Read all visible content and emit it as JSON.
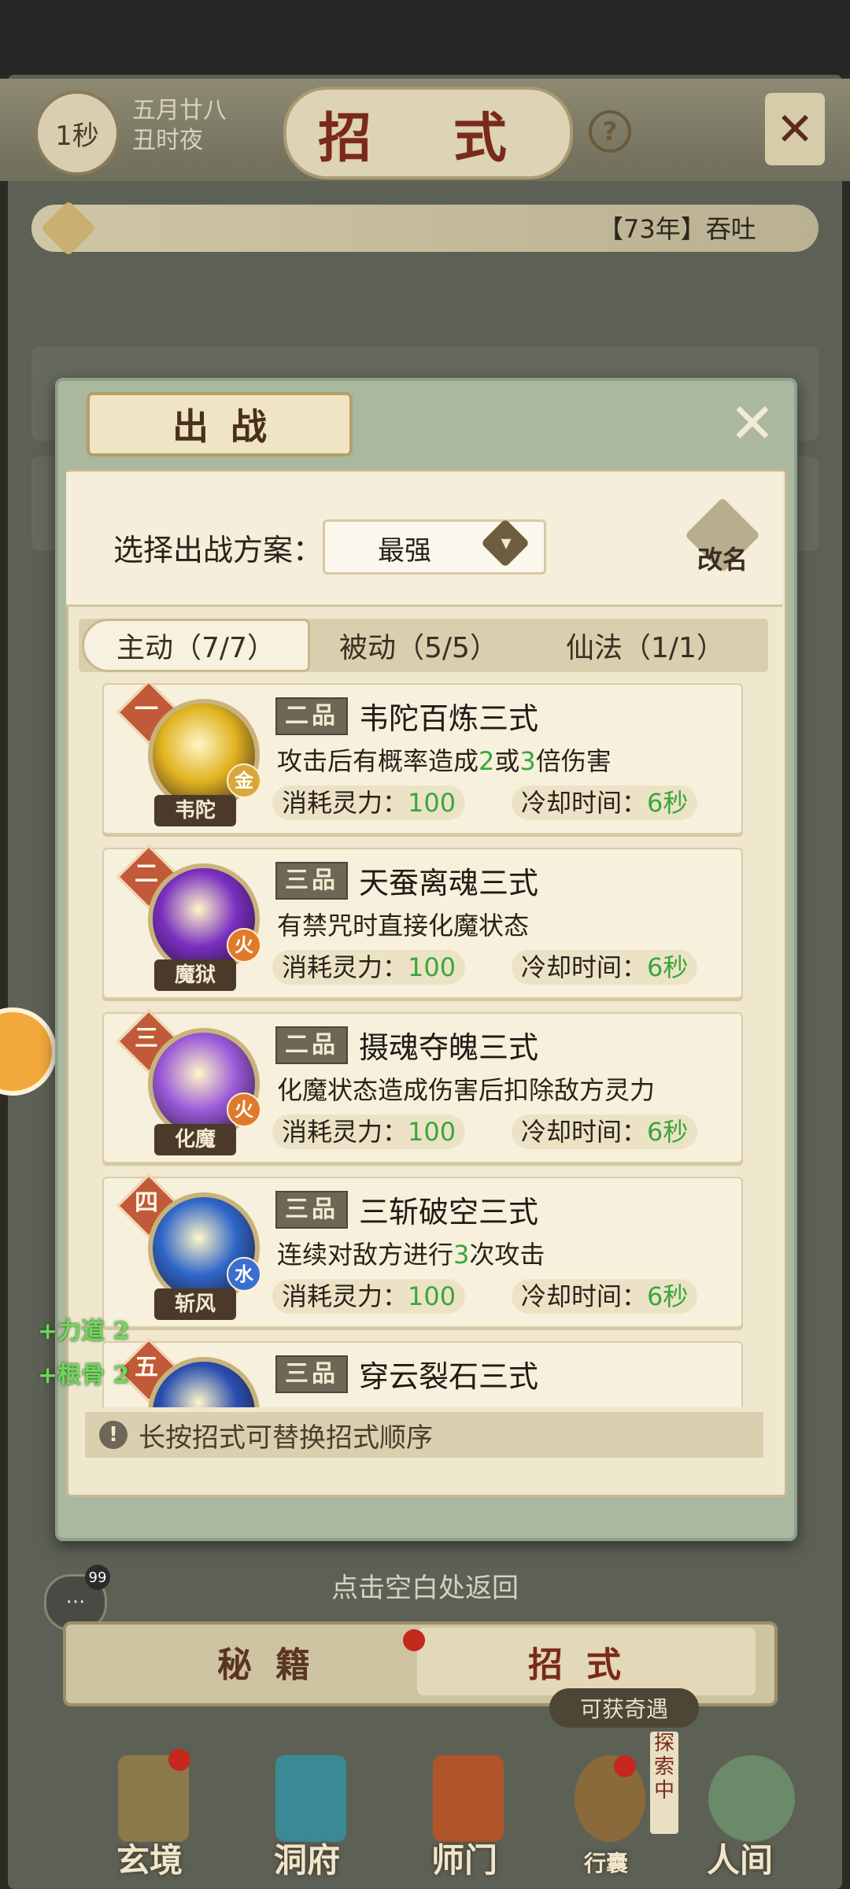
{
  "header": {
    "timer": "1秒",
    "date_line1": "五月廿八",
    "date_line2": "丑时夜",
    "title": "招 式",
    "help": "?",
    "close": "✕"
  },
  "notice": {
    "text": "【73年】吞吐"
  },
  "modal": {
    "title": "出战",
    "close": "✕",
    "plan_label": "选择出战方案：",
    "plan_value": "最强",
    "rename_label": "改名",
    "tabs": [
      {
        "label": "主动（7/7）"
      },
      {
        "label": "被动（5/5）"
      },
      {
        "label": "仙法（1/1）"
      }
    ],
    "skills": [
      {
        "rank": "一",
        "icon_name": "韦陀",
        "element": "金",
        "element_color": "#d8a93a",
        "grade": "二品",
        "name": "韦陀百炼三式",
        "desc_parts": [
          "攻击后有概率造成",
          "2",
          "或",
          "3",
          "倍伤害"
        ],
        "cost_label": "消耗灵力：",
        "cost": "100",
        "cd_label": "冷却时间：",
        "cd": "6秒",
        "icon_color": "#e0b21f"
      },
      {
        "rank": "二",
        "icon_name": "魔狱",
        "element": "火",
        "element_color": "#e07a2a",
        "grade": "三品",
        "name": "天蚕离魂三式",
        "desc_parts": [
          "有禁咒时直接化魔状态"
        ],
        "cost_label": "消耗灵力：",
        "cost": "100",
        "cd_label": "冷却时间：",
        "cd": "6秒",
        "icon_color": "#7a2fc0"
      },
      {
        "rank": "三",
        "icon_name": "化魔",
        "element": "火",
        "element_color": "#e07a2a",
        "grade": "二品",
        "name": "摄魂夺魄三式",
        "desc_parts": [
          "化魔状态造成伤害后扣除敌方灵力"
        ],
        "cost_label": "消耗灵力：",
        "cost": "100",
        "cd_label": "冷却时间：",
        "cd": "6秒",
        "icon_color": "#9a5ad8"
      },
      {
        "rank": "四",
        "icon_name": "斩风",
        "element": "水",
        "element_color": "#3a6fd0",
        "grade": "三品",
        "name": "三斩破空三式",
        "desc_parts": [
          "连续对敌方进行",
          "3",
          "次攻击"
        ],
        "cost_label": "消耗灵力：",
        "cost": "100",
        "cd_label": "冷却时间：",
        "cd": "6秒",
        "icon_color": "#2f66c8"
      },
      {
        "rank": "五",
        "icon_name": "",
        "element": "",
        "element_color": "#3a6fd0",
        "grade": "三品",
        "name": "穿云裂石三式",
        "desc_parts": [
          ""
        ],
        "cost_label": "",
        "cost": "",
        "cd_label": "",
        "cd": "",
        "icon_color": "#2a4fb0"
      }
    ],
    "hint": "长按招式可替换招式顺序"
  },
  "buffs": [
    "+力道 2",
    "+根骨 2"
  ],
  "return_hint": "点击空白处返回",
  "chat": {
    "badge": "99"
  },
  "bottom_tabs": {
    "left": "秘籍",
    "right": "招式"
  },
  "encounter": "可获奇遇",
  "explore_tag": "探索中",
  "nav": [
    {
      "label": "玄境",
      "color": "#8a7a4a"
    },
    {
      "label": "洞府",
      "color": "#3a8a96"
    },
    {
      "label": "师门",
      "color": "#b0542a"
    },
    {
      "label": "行囊",
      "color": "#8a6a3a"
    },
    {
      "label": "人间",
      "color": "#6a8a6a"
    }
  ],
  "colors": {
    "accent_green": "#3aa63a",
    "rank_red": "#c05a38"
  }
}
